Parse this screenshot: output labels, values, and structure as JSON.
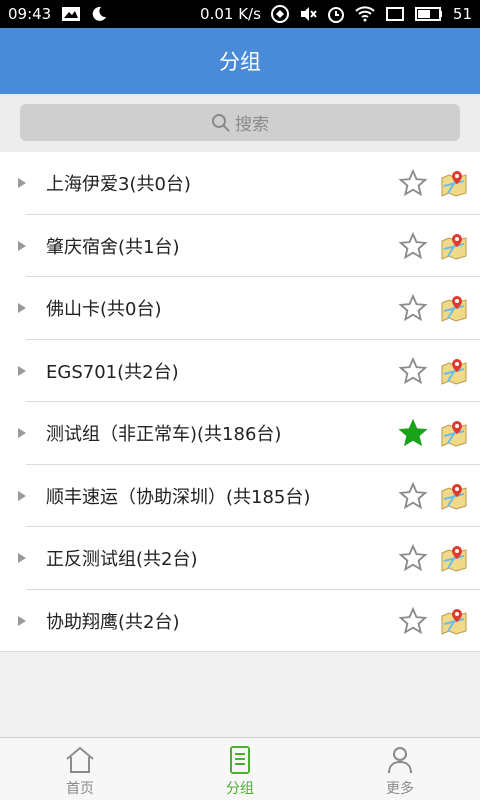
{
  "status": {
    "time": "09:43",
    "speed": "0.01 K/s",
    "battery": "51"
  },
  "header": {
    "title": "分组"
  },
  "search": {
    "placeholder": "搜索"
  },
  "groups": [
    {
      "label": "上海伊爱3(共0台)",
      "favorite": false
    },
    {
      "label": "肇庆宿舍(共1台)",
      "favorite": false
    },
    {
      "label": "佛山卡(共0台)",
      "favorite": false
    },
    {
      "label": "EGS701(共2台)",
      "favorite": false
    },
    {
      "label": "测试组（非正常车)(共186台)",
      "favorite": true
    },
    {
      "label": "顺丰速运（协助深圳）(共185台)",
      "favorite": false
    },
    {
      "label": "正反测试组(共2台)",
      "favorite": false
    },
    {
      "label": "协助翔鹰(共2台)",
      "favorite": false
    }
  ],
  "tabs": [
    {
      "label": "首页",
      "icon": "home-icon",
      "active": false
    },
    {
      "label": "分组",
      "icon": "group-list-icon",
      "active": true
    },
    {
      "label": "更多",
      "icon": "person-icon",
      "active": false
    }
  ],
  "colors": {
    "header": "#4a8bd9",
    "active": "#4caf2f",
    "favorite": "#1aa31a"
  }
}
